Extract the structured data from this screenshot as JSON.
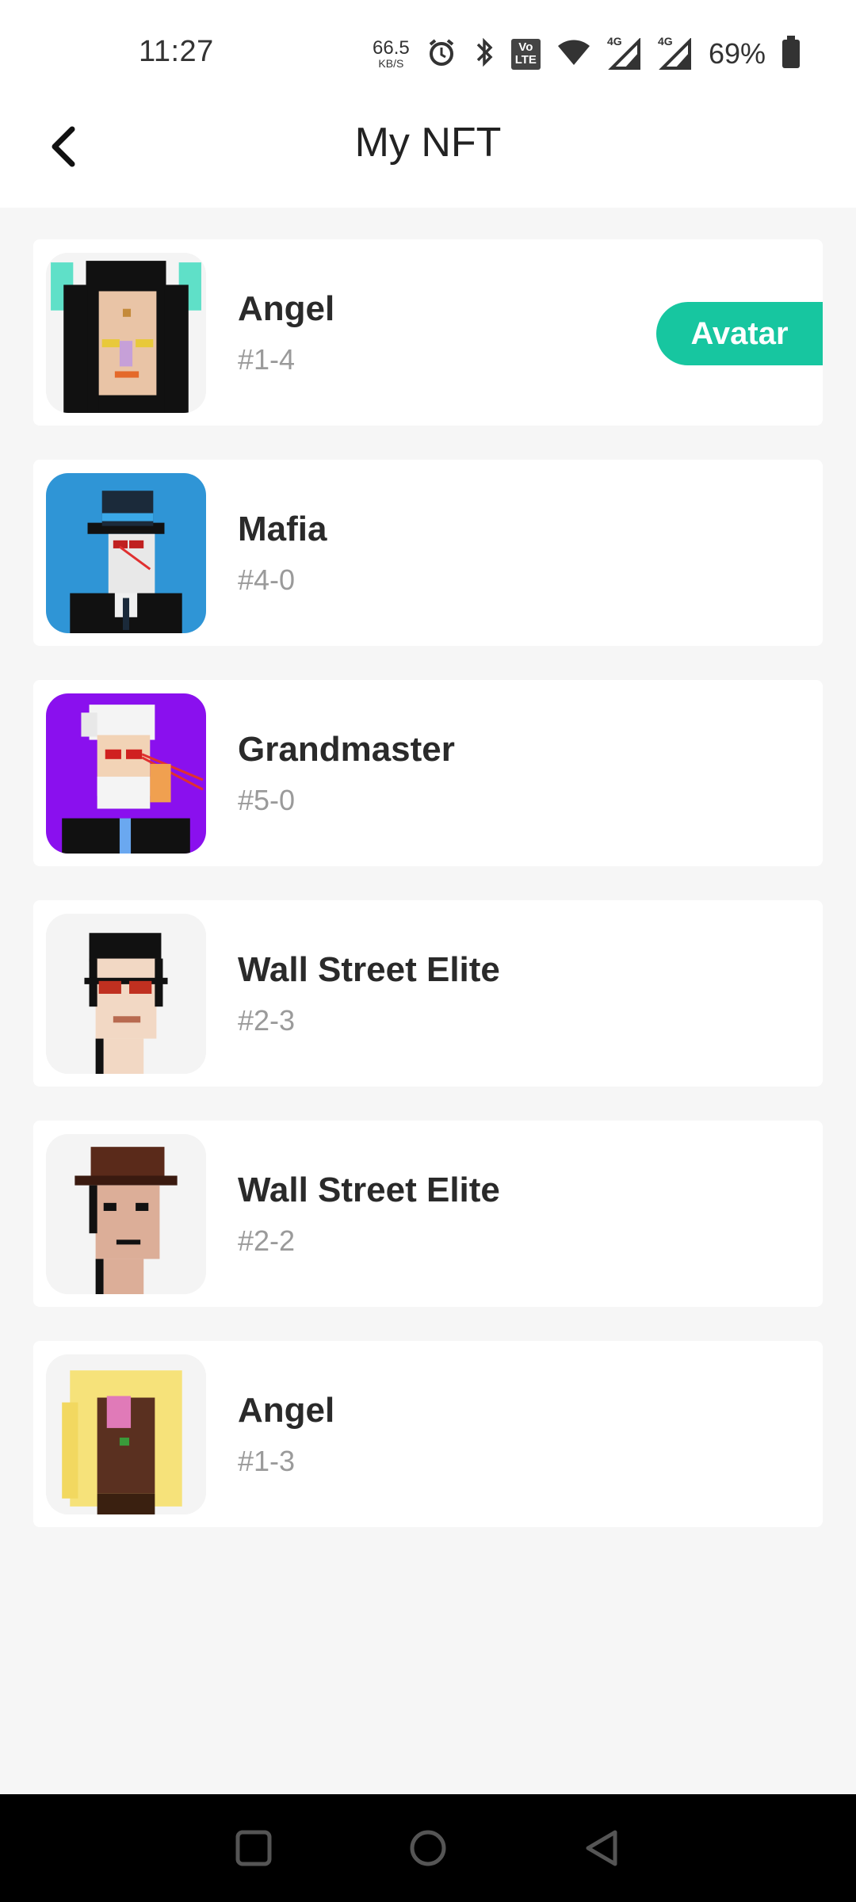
{
  "status": {
    "time": "11:27",
    "net_speed_value": "66.5",
    "net_speed_unit": "KB/S",
    "volte_label_1": "Vo",
    "volte_label_2": "LTE",
    "signal_1_label": "4G",
    "signal_2_label": "4G",
    "battery": "69%"
  },
  "header": {
    "title": "My NFT"
  },
  "items": [
    {
      "name": "Angel",
      "id": "#1-4",
      "tag": "Avatar"
    },
    {
      "name": "Mafia",
      "id": "#4-0"
    },
    {
      "name": "Grandmaster",
      "id": "#5-0"
    },
    {
      "name": "Wall Street Elite",
      "id": "#2-3"
    },
    {
      "name": "Wall Street Elite",
      "id": "#2-2"
    },
    {
      "name": "Angel",
      "id": "#1-3"
    }
  ],
  "colors": {
    "accent": "#17c6a0",
    "mafia_bg": "#2f95d6",
    "grandmaster_bg": "#8a10ee"
  },
  "icons": {
    "back": "back-arrow-icon",
    "nav_recent": "square-icon",
    "nav_home": "circle-icon",
    "nav_back": "triangle-back-icon"
  }
}
